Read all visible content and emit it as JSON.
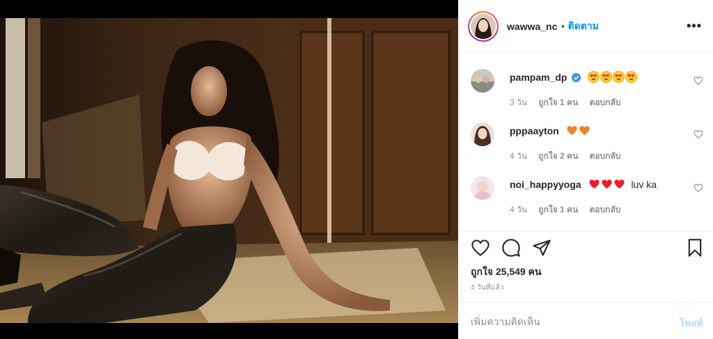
{
  "post": {
    "author": "wawwa_nc",
    "separator": "•",
    "follow_label": "ติดตาม",
    "more_icon": "more-dots-icon"
  },
  "comments": [
    {
      "username": "pampam_dp",
      "verified": true,
      "emoji_count": 4,
      "emoji": "heart-eyes-emoji",
      "text": "",
      "age": "3 วัน",
      "likes": "ถูกใจ 1 คน",
      "reply": "ตอบกลับ"
    },
    {
      "username": "pppaayton",
      "verified": false,
      "emoji_count": 2,
      "emoji": "orange-heart-emoji",
      "text": "",
      "age": "4 วัน",
      "likes": "ถูกใจ 2 คน",
      "reply": "ตอบกลับ"
    },
    {
      "username": "noi_happyyoga",
      "verified": false,
      "emoji_count": 3,
      "emoji": "red-heart-emoji",
      "text": "luv ka",
      "age": "4 วัน",
      "likes": "ถูกใจ 1 คน",
      "reply": "ตอบกลับ"
    }
  ],
  "actions": {
    "like_icon": "heart-icon",
    "comment_icon": "comment-icon",
    "share_icon": "share-icon",
    "save_icon": "bookmark-icon"
  },
  "likes_text": "ถูกใจ 25,549 คน",
  "time_text": "4 วันที่แล้ว",
  "add_comment": {
    "placeholder": "เพิ่มความคิดเห็น",
    "post_label": "โพสต์"
  },
  "colors": {
    "link_blue": "#0095f6",
    "post_disabled": "#b3dbff",
    "secondary_text": "#8e8e8e",
    "divider": "#efefef",
    "heart_red": "#ed1c24",
    "heart_orange": "#f4811f"
  }
}
